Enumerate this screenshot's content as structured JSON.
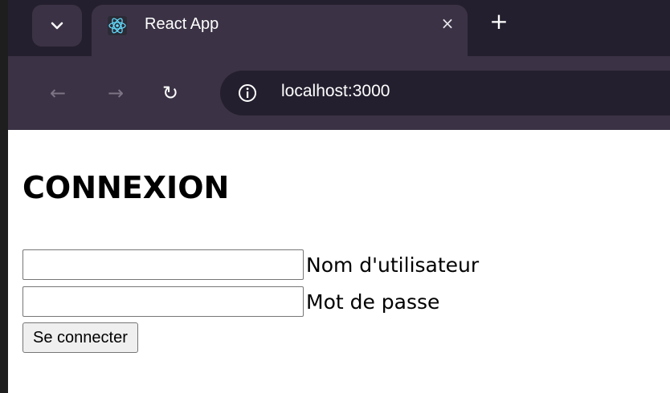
{
  "browser": {
    "tab": {
      "title": "React App",
      "close_glyph": "×",
      "favicon": "react-logo-icon"
    },
    "new_tab_glyph": "+",
    "tab_list_glyph": "⌄",
    "nav": {
      "back_glyph": "←",
      "forward_glyph": "→",
      "reload_glyph": "↻"
    },
    "address_bar": {
      "url": "localhost:3000",
      "site_info_icon": "info-icon"
    },
    "colors": {
      "tabstrip": "#241f2e",
      "toolbar": "#3b3345",
      "react_logo": "#61dafb"
    }
  },
  "page": {
    "title": "CONNEXION",
    "fields": [
      {
        "label": "Nom d'utilisateur",
        "value": ""
      },
      {
        "label": "Mot de passe",
        "value": ""
      }
    ],
    "submit_label": "Se connecter"
  }
}
